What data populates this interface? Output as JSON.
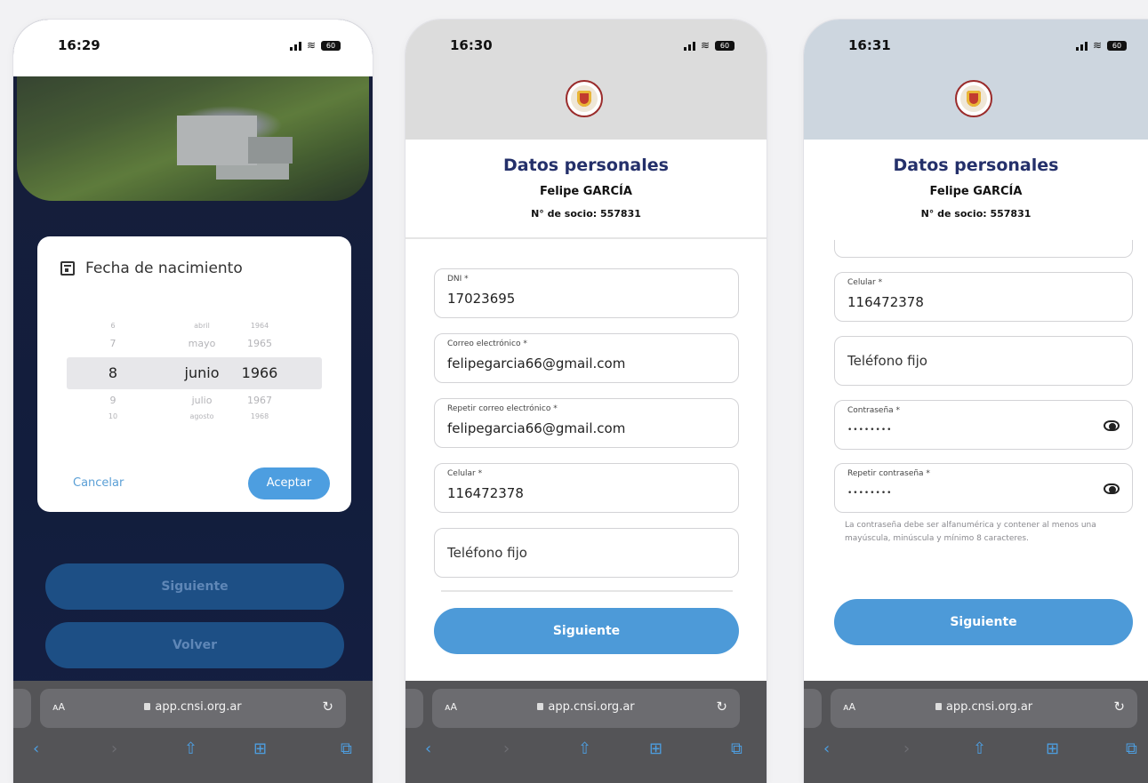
{
  "screens": [
    {
      "time": "16:29",
      "battery": "60",
      "dialog": {
        "title": "Fecha de nacimiento",
        "rows": [
          [
            "6",
            "abril",
            "1964"
          ],
          [
            "7",
            "mayo",
            "1965"
          ],
          [
            "8",
            "junio",
            "1966"
          ],
          [
            "9",
            "julio",
            "1967"
          ],
          [
            "10",
            "agosto",
            "1968"
          ]
        ],
        "cancel": "Cancelar",
        "accept": "Aceptar"
      },
      "buttons": {
        "next": "Siguiente",
        "back": "Volver"
      },
      "url": "app.cnsi.org.ar"
    },
    {
      "time": "16:30",
      "battery": "60",
      "heading": "Datos personales",
      "name": "Felipe GARCÍA",
      "member": "N° de socio: 557831",
      "fields": [
        {
          "label": "DNI *",
          "value": "17023695"
        },
        {
          "label": "Correo electrónico *",
          "value": "felipegarcia66@gmail.com"
        },
        {
          "label": "Repetir correo electrónico *",
          "value": "felipegarcia66@gmail.com"
        },
        {
          "label": "Celular *",
          "value": "116472378"
        },
        {
          "placeholder": "Teléfono fijo"
        }
      ],
      "next": "Siguiente",
      "url": "app.cnsi.org.ar"
    },
    {
      "time": "16:31",
      "battery": "60",
      "heading": "Datos personales",
      "name": "Felipe GARCÍA",
      "member": "N° de socio: 557831",
      "fields": [
        {
          "label": "Celular *",
          "value": "116472378"
        },
        {
          "placeholder": "Teléfono fijo"
        },
        {
          "label": "Contraseña *",
          "value": "••••••••"
        },
        {
          "label": "Repetir contraseña *",
          "value": "••••••••"
        }
      ],
      "hint": "La contraseña debe ser alfanumérica y contener al menos una mayúscula, minúscula y mínimo 8 caracteres.",
      "next": "Siguiente",
      "url": "app.cnsi.org.ar"
    }
  ],
  "icons": [
    "calendar-icon",
    "eye-icon",
    "lock-icon",
    "reload-icon",
    "back-icon",
    "forward-icon",
    "share-icon",
    "bookmarks-icon",
    "tabs-icon"
  ],
  "colors": {
    "accent": "#4d9ad8",
    "heading": "#24306a",
    "dark-button": "#1d4f85"
  }
}
